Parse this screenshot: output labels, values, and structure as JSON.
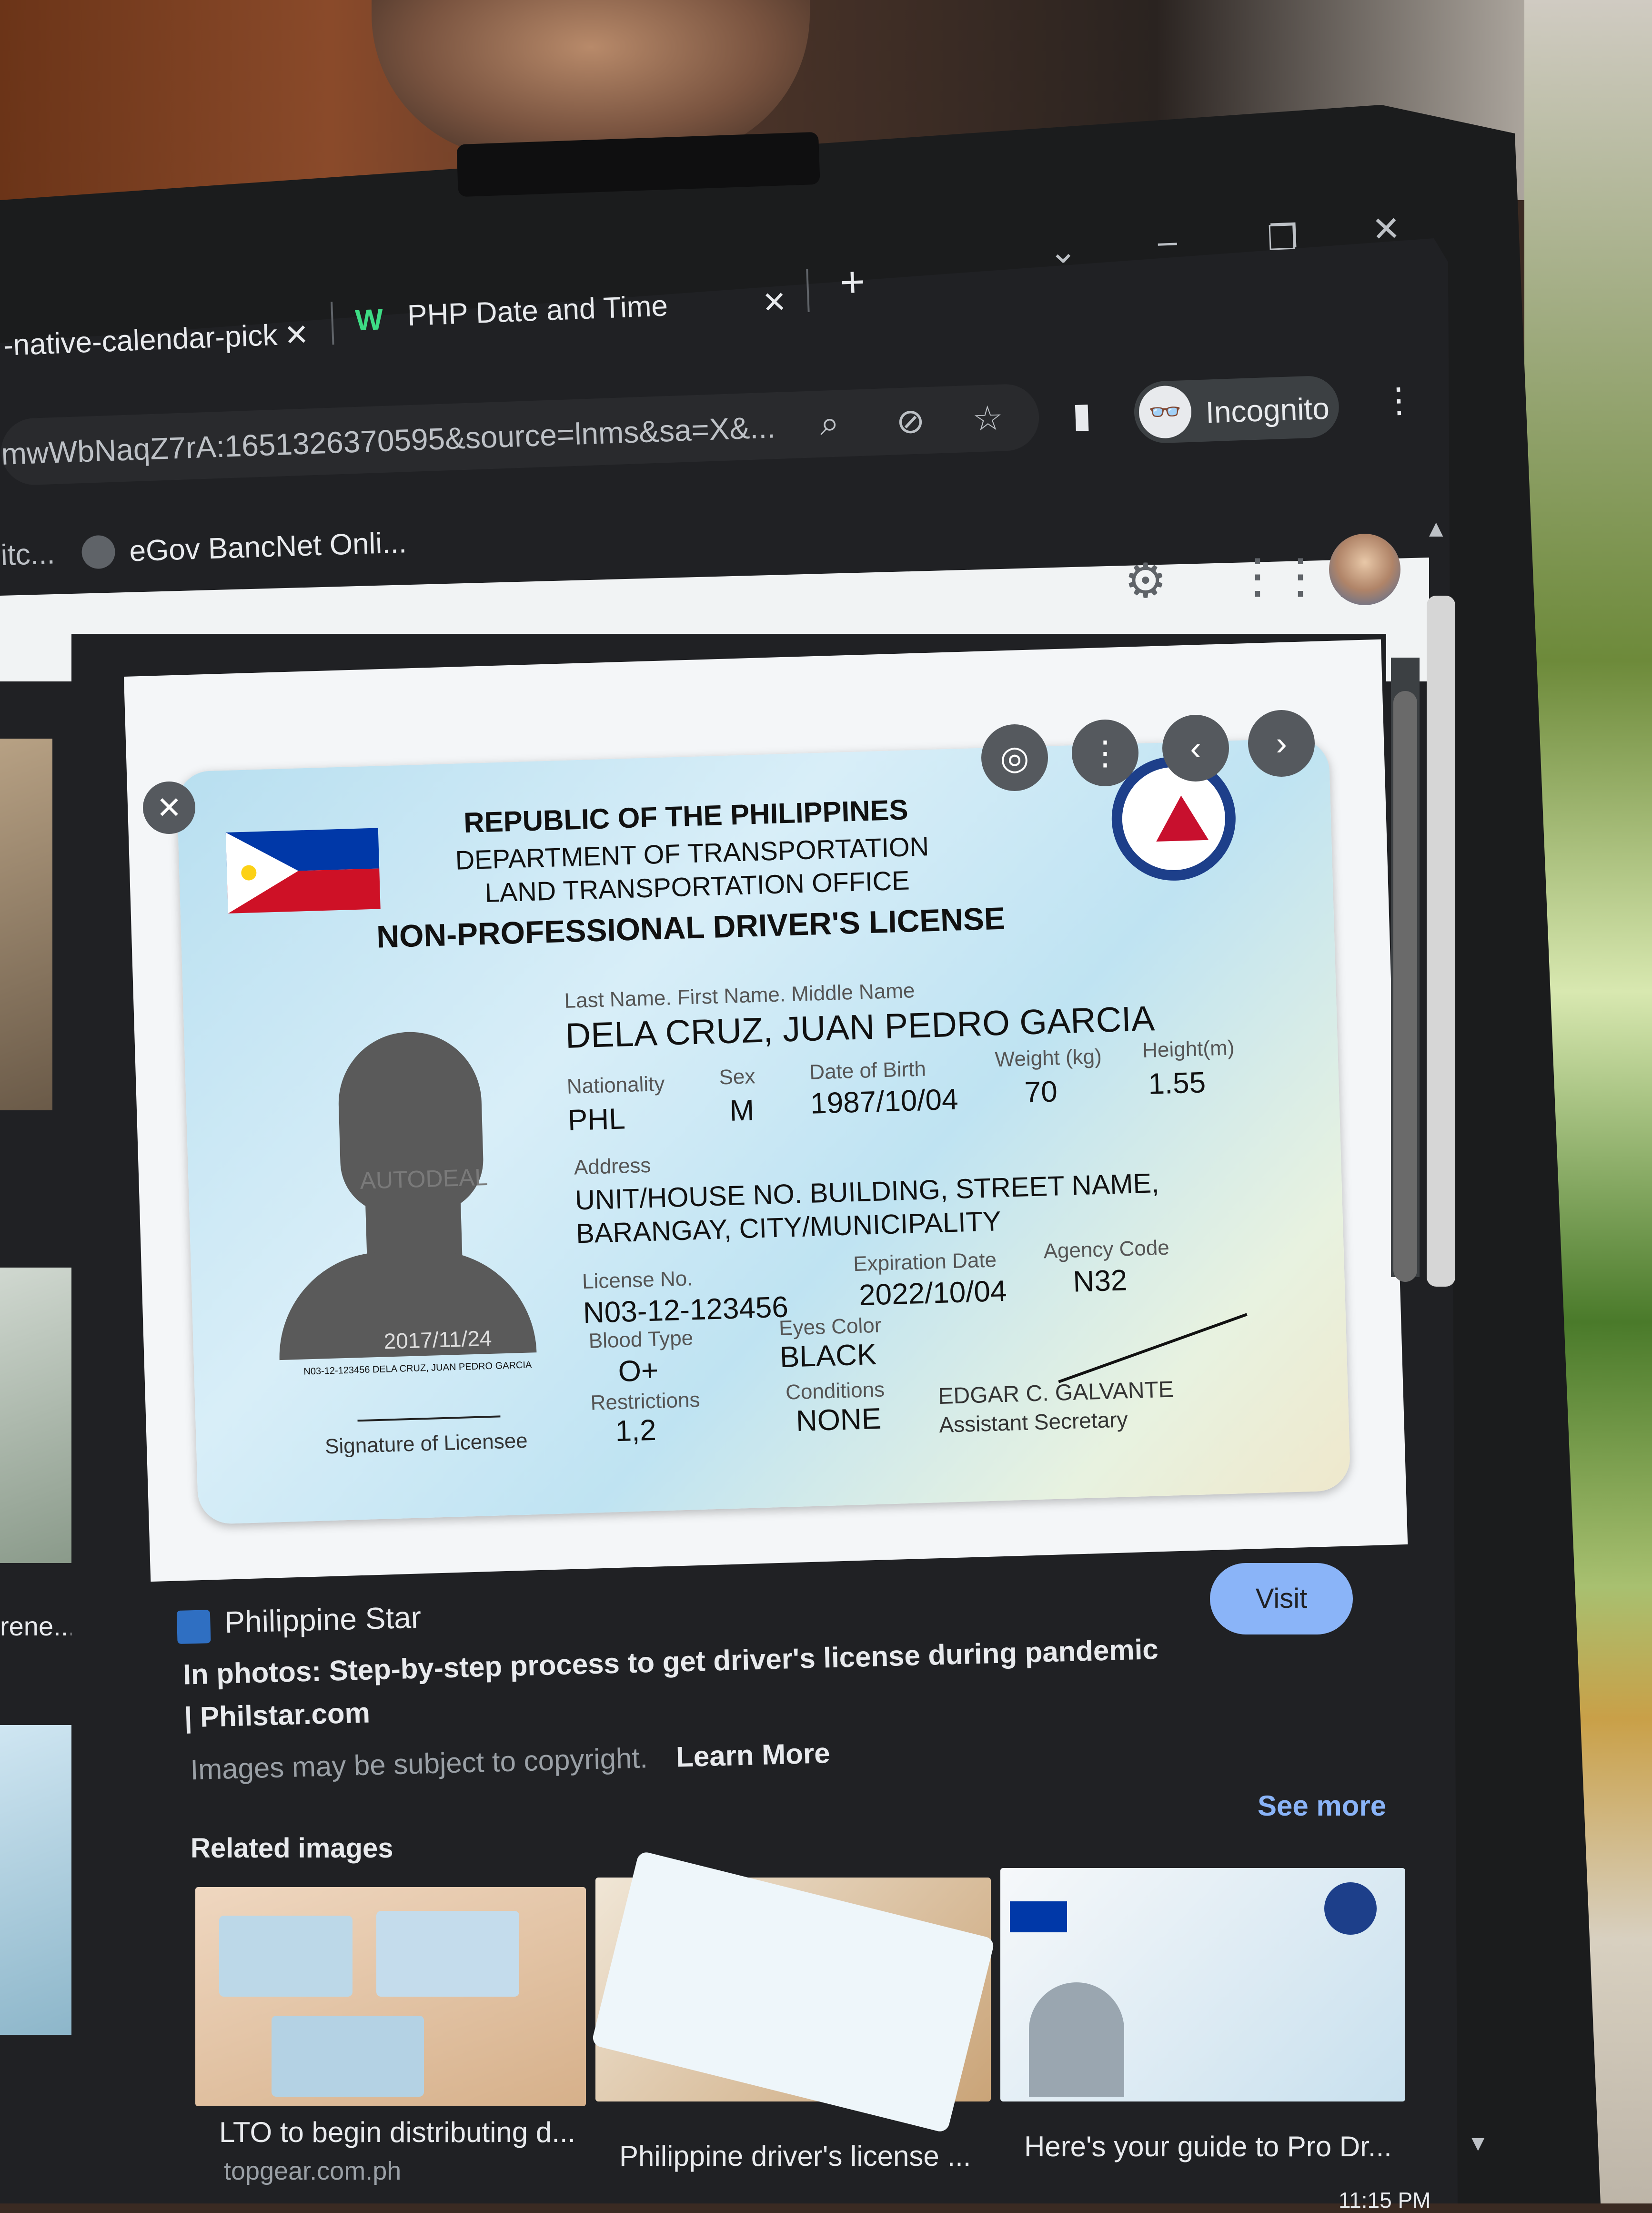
{
  "browser": {
    "tabs": [
      {
        "label": "-native-calendar-pick",
        "close": "✕"
      },
      {
        "label": "PHP Date and Time",
        "close": "✕"
      }
    ],
    "new_tab": "+",
    "window_controls": {
      "dropdown": "⌄",
      "minimize": "–",
      "restore": "❐",
      "close": "✕"
    },
    "url": "mwWbNaqZ7rA:1651326370595&source=lnms&sa=X&...",
    "mode_label": "Incognito",
    "menu": "⋮",
    "bookmarks": [
      {
        "label": "itc..."
      },
      {
        "label": "eGov BancNet Onli..."
      }
    ]
  },
  "lightbox": {
    "license": {
      "header_line1": "REPUBLIC OF THE PHILIPPINES",
      "header_line2": "DEPARTMENT OF TRANSPORTATION",
      "header_line3": "LAND TRANSPORTATION OFFICE",
      "title": "NON-PROFESSIONAL DRIVER'S LICENSE",
      "name_label": "Last Name. First Name. Middle Name",
      "name": "DELA CRUZ, JUAN PEDRO GARCIA",
      "nationality_label": "Nationality",
      "nationality": "PHL",
      "sex_label": "Sex",
      "sex": "M",
      "dob_label": "Date of Birth",
      "dob": "1987/10/04",
      "weight_label": "Weight (kg)",
      "weight": "70",
      "height_label": "Height(m)",
      "height": "1.55",
      "address_label": "Address",
      "address_line1": "UNIT/HOUSE NO. BUILDING, STREET NAME,",
      "address_line2": "BARANGAY, CITY/MUNICIPALITY",
      "license_no_label": "License No.",
      "license_no": "N03-12-123456",
      "expiration_label": "Expiration Date",
      "expiration": "2022/10/04",
      "agency_label": "Agency Code",
      "agency": "N32",
      "blood_label": "Blood Type",
      "blood": "O+",
      "eyes_label": "Eyes Color",
      "eyes": "BLACK",
      "restrictions_label": "Restrictions",
      "restrictions": "1,2",
      "conditions_label": "Conditions",
      "conditions": "NONE",
      "photo_watermark": "AUTODEAL",
      "photo_date": "2017/11/24",
      "photo_caption": "N03-12-123456 DELA CRUZ, JUAN PEDRO GARCIA",
      "signature_label": "Signature of Licensee",
      "official_name": "EDGAR C. GALVANTE",
      "official_title": "Assistant Secretary"
    },
    "source_name": "Philippine Star",
    "headline_line1": "In photos: Step-by-step process to get driver's license during pandemic",
    "headline_line2": "| Philstar.com",
    "copyright_text": "Images may be subject to copyright.",
    "learn_more": "Learn More",
    "visit_label": "Visit",
    "see_more": "See more",
    "related_title": "Related images",
    "related": [
      {
        "title": "LTO to begin distributing d...",
        "source": "topgear.com.ph"
      },
      {
        "title": "Philippine driver's license ...",
        "source": ""
      },
      {
        "title": "Here's your guide to Pro Dr...",
        "source": ""
      }
    ],
    "left_column_caption": "rene..."
  },
  "clock": "11:15 PM",
  "colors": {
    "chrome_dark": "#202124",
    "accent": "#8ab4f8",
    "flag_blue": "#0038a8",
    "flag_red": "#ce1126",
    "flag_yellow": "#fcd116"
  }
}
